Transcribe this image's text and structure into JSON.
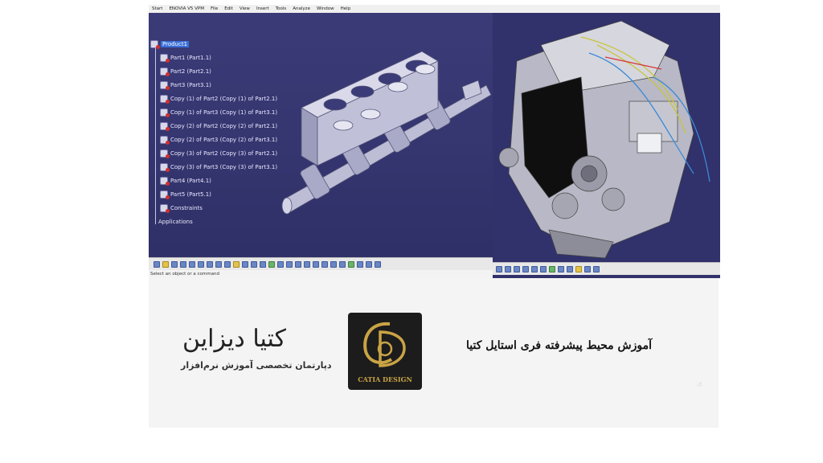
{
  "left_window": {
    "menu": [
      "Start",
      "ENOVIA V5 VPM",
      "File",
      "Edit",
      "View",
      "Insert",
      "Tools",
      "Analyze",
      "Window",
      "Help"
    ],
    "tree": [
      {
        "label": "Product1",
        "kind": "root"
      },
      {
        "label": "Part1 (Part1.1)",
        "kind": "part"
      },
      {
        "label": "Part2 (Part2.1)",
        "kind": "part"
      },
      {
        "label": "Part3 (Part3.1)",
        "kind": "part"
      },
      {
        "label": "Copy (1) of Part2 (Copy (1) of Part2.1)",
        "kind": "part"
      },
      {
        "label": "Copy (1) of Part3 (Copy (1) of Part3.1)",
        "kind": "part"
      },
      {
        "label": "Copy (2) of Part2 (Copy (2) of Part2.1)",
        "kind": "part"
      },
      {
        "label": "Copy (2) of Part3 (Copy (2) of Part3.1)",
        "kind": "part"
      },
      {
        "label": "Copy (3) of Part2 (Copy (3) of Part2.1)",
        "kind": "part"
      },
      {
        "label": "Copy (3) of Part3 (Copy (3) of Part3.1)",
        "kind": "part"
      },
      {
        "label": "Part4 (Part4.1)",
        "kind": "part"
      },
      {
        "label": "Part5 (Part5.1)",
        "kind": "part"
      },
      {
        "label": "Constraints",
        "kind": "constraints"
      },
      {
        "label": "Applications",
        "kind": "applications"
      }
    ],
    "status": "Select an object or a command",
    "colors": {
      "viewport_bg": "#34346f",
      "selection": "#3a6fd8"
    }
  },
  "bottom": {
    "logo_name": "کتیا دیزاین",
    "logo_tagline": "دپارتمان تخصصی آموزش نرم‌افزار",
    "logo_badge_text": "CATIA DESIGN",
    "course_title": "آموزش محیط پیشرفته فری استایل کتیا"
  }
}
